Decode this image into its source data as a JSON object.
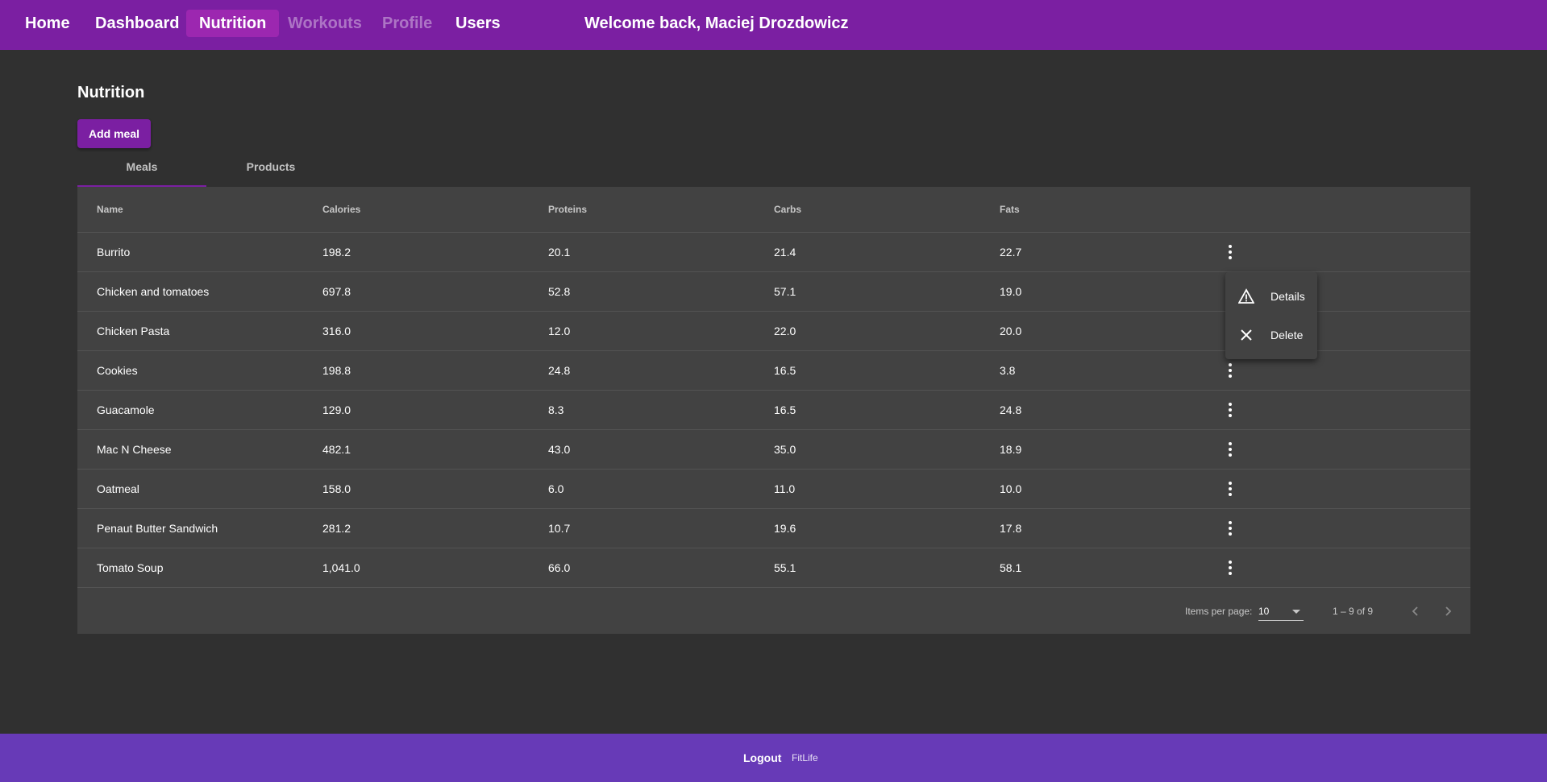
{
  "nav": {
    "items": [
      {
        "label": "Home",
        "state": "normal"
      },
      {
        "label": "Dashboard",
        "state": "normal"
      },
      {
        "label": "Nutrition",
        "state": "active"
      },
      {
        "label": "Workouts",
        "state": "disabled"
      },
      {
        "label": "Profile",
        "state": "disabled"
      },
      {
        "label": "Users",
        "state": "normal"
      }
    ],
    "welcome": "Welcome back, Maciej Drozdowicz"
  },
  "page": {
    "title": "Nutrition",
    "add_button": "Add meal",
    "tabs": [
      {
        "label": "Meals",
        "active": true
      },
      {
        "label": "Products",
        "active": false
      }
    ]
  },
  "table": {
    "headers": [
      "Name",
      "Calories",
      "Proteins",
      "Carbs",
      "Fats"
    ],
    "rows": [
      [
        "Burrito",
        "198.2",
        "20.1",
        "21.4",
        "22.7"
      ],
      [
        "Chicken and tomatoes",
        "697.8",
        "52.8",
        "57.1",
        "19.0"
      ],
      [
        "Chicken Pasta",
        "316.0",
        "12.0",
        "22.0",
        "20.0"
      ],
      [
        "Cookies",
        "198.8",
        "24.8",
        "16.5",
        "3.8"
      ],
      [
        "Guacamole",
        "129.0",
        "8.3",
        "16.5",
        "24.8"
      ],
      [
        "Mac N Cheese",
        "482.1",
        "43.0",
        "35.0",
        "18.9"
      ],
      [
        "Oatmeal",
        "158.0",
        "6.0",
        "11.0",
        "10.0"
      ],
      [
        "Penaut Butter Sandwich",
        "281.2",
        "10.7",
        "19.6",
        "17.8"
      ],
      [
        "Tomato Soup",
        "1,041.0",
        "66.0",
        "55.1",
        "58.1"
      ]
    ]
  },
  "row_menu": {
    "items": [
      {
        "label": "Details",
        "icon": "warning-icon"
      },
      {
        "label": "Delete",
        "icon": "close-icon"
      }
    ]
  },
  "paginator": {
    "items_per_page_label": "Items per page:",
    "items_per_page": "10",
    "range": "1 – 9 of 9"
  },
  "footer": {
    "logout": "Logout",
    "brand": "FitLife"
  },
  "colors": {
    "topbar": "#7b1fa2",
    "footer": "#673ab7",
    "background": "#303030",
    "card": "#424242"
  }
}
